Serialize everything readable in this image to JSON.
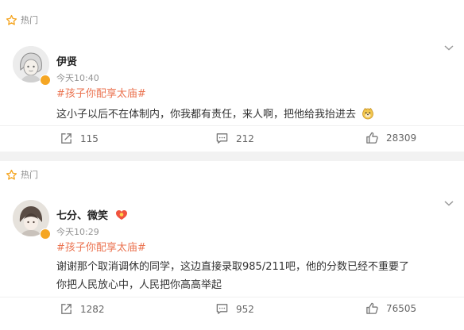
{
  "posts": [
    {
      "hot_label": "热门",
      "user_name": "伊贤",
      "time": "今天10:40",
      "topic": "#孩子你配享太庙#",
      "lines": [
        "这小子以后不在体制内，你我都有责任，来人啊，把他给我抬进去"
      ],
      "emoji": "doge-emoji",
      "repost_count": "115",
      "comment_count": "212",
      "like_count": "28309"
    },
    {
      "hot_label": "热门",
      "user_name": "七分、微笑",
      "time": "今天10:29",
      "topic": "#孩子你配享太庙#",
      "lines": [
        "谢谢那个取消调休的同学，这边直接录取985/211吧，他的分数已经不重要了",
        "你把人民放心中，人民把你高高举起"
      ],
      "repost_count": "1282",
      "comment_count": "952",
      "like_count": "76505"
    }
  ],
  "colors": {
    "topic": "#eb7350",
    "hot_star": "#f5a623",
    "verified_badge": "#f5a623",
    "background": "#f2f2f2"
  }
}
